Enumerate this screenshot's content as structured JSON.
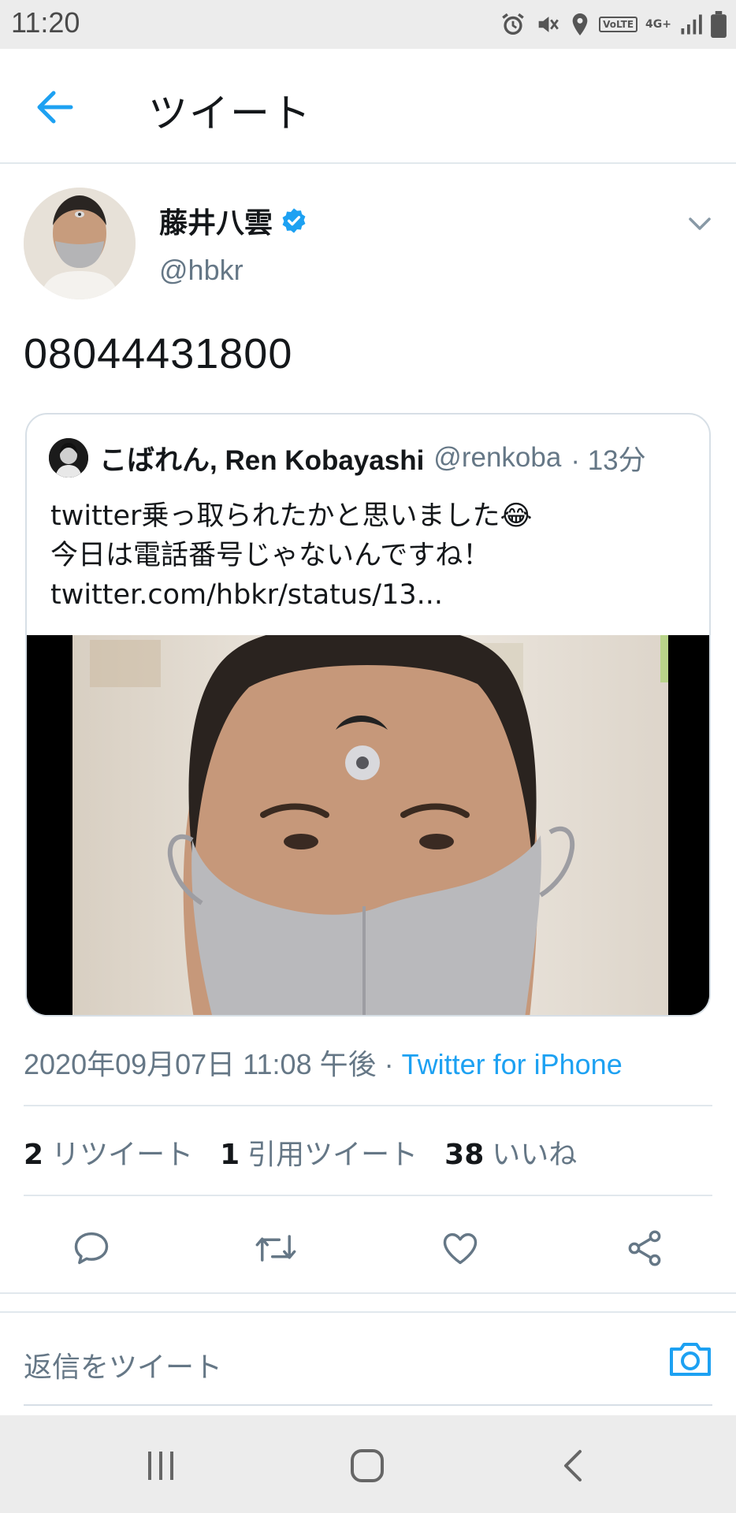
{
  "status_bar": {
    "time": "11:20",
    "volte_label": "VoLTE",
    "network_label": "4G+"
  },
  "header": {
    "title": "ツイート"
  },
  "tweet": {
    "author_name": "藤井八雲",
    "author_handle": "@hbkr",
    "text": "08044431800",
    "timestamp": "2020年09月07日 11:08 午後",
    "separator": " · ",
    "source": "Twitter for iPhone"
  },
  "quoted_tweet": {
    "author_name": "こばれん, Ren Kobayashi",
    "author_handle": "@renkoba",
    "time_ago": "· 13分",
    "lines": [
      "twitter乗っ取られたかと思いました😂",
      "今日は電話番号じゃないんですね！",
      "twitter.com/hbkr/status/13..."
    ]
  },
  "stats": {
    "retweets_count": "2",
    "retweets_label": "リツイート",
    "quotes_count": "1",
    "quotes_label": "引用ツイート",
    "likes_count": "38",
    "likes_label": "いいね"
  },
  "reply": {
    "placeholder": "返信をツイート"
  },
  "colors": {
    "accent": "#1da1f2",
    "secondary_text": "#657786",
    "divider": "#e1e8ed"
  },
  "icons": {
    "back": "arrow-left-icon",
    "verified": "verified-badge-icon",
    "more": "chevron-down-icon",
    "reply": "reply-icon",
    "retweet": "retweet-icon",
    "like": "heart-icon",
    "share": "share-icon",
    "camera": "camera-icon",
    "nav_recent": "recent-apps-icon",
    "nav_home": "home-icon",
    "nav_back": "back-icon"
  }
}
